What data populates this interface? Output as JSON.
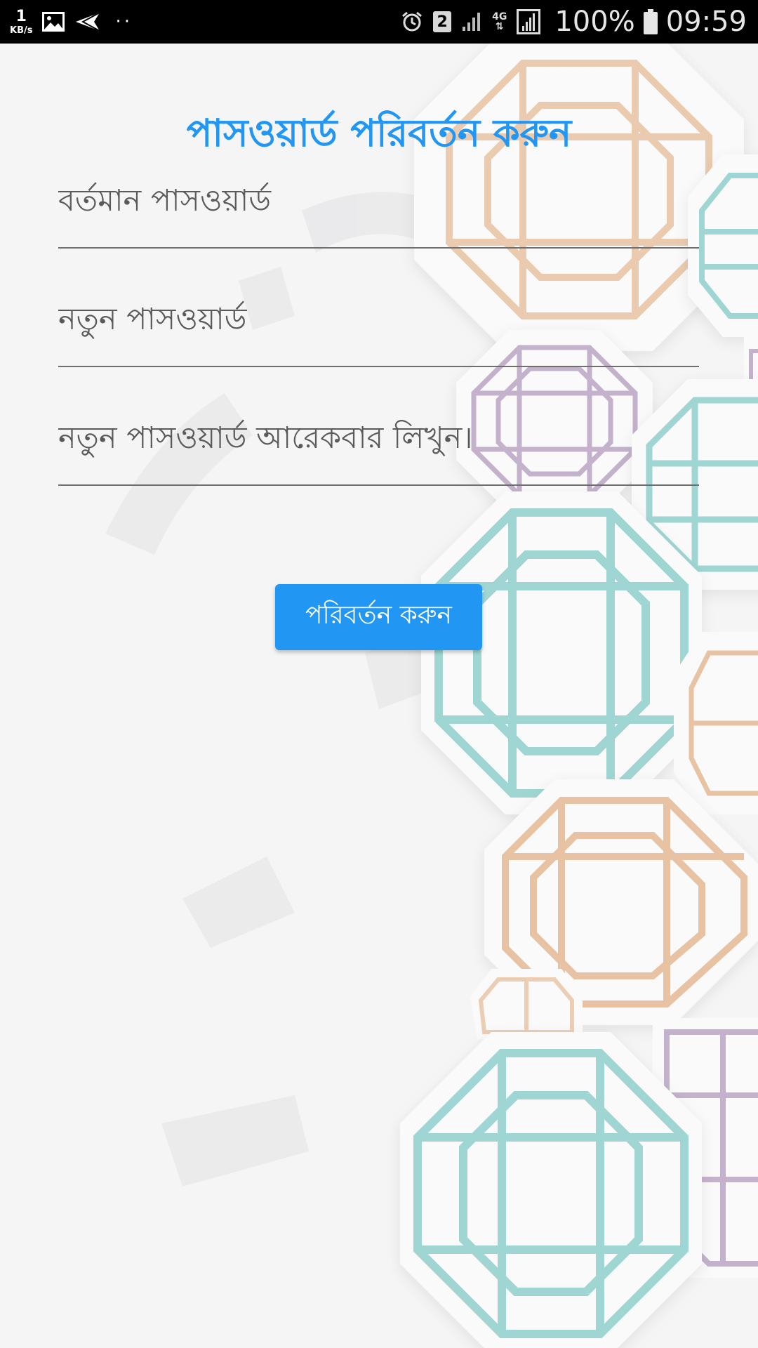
{
  "status_bar": {
    "net_speed_value": "1",
    "net_speed_unit": "KB/s",
    "dots": "··",
    "sim_slot": "2",
    "network_type": "4G",
    "battery_percent": "100%",
    "time": "09:59",
    "icons": [
      "image-icon",
      "send-icon",
      "alarm-icon",
      "signal-icon",
      "battery-icon"
    ]
  },
  "page": {
    "title": "পাসওয়ার্ড পরিবর্তন করুন"
  },
  "form": {
    "current_password": {
      "value": "",
      "placeholder": "বর্তমান পাসওয়ার্ড"
    },
    "new_password": {
      "value": "",
      "placeholder": "নতুন পাসওয়ার্ড"
    },
    "confirm_password": {
      "value": "",
      "placeholder": "নতুন পাসওয়ার্ড আরেকবার লিখুন।"
    },
    "submit_label": "পরিবর্তন করুন"
  },
  "colors": {
    "accent": "#2196f3",
    "background": "#f5f5f6",
    "deco_peach": "#e8c3a3",
    "deco_teal": "#9fd6d3",
    "deco_lavender": "#c4b2cc"
  }
}
